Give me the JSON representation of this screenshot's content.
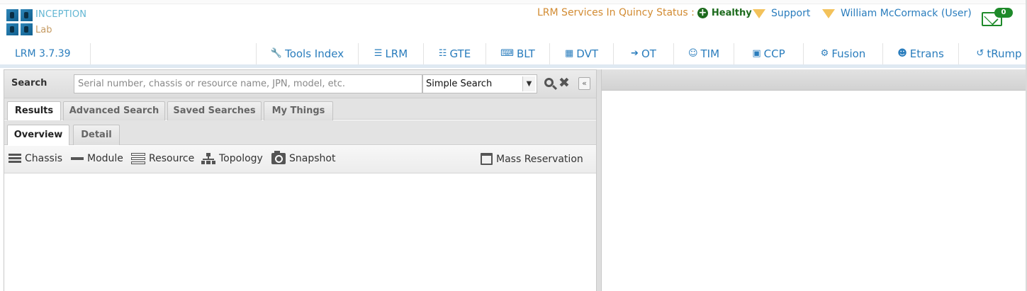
{
  "header": {
    "logo_title": "INCEPTION",
    "logo_subtitle": "Lab",
    "status_label": "LRM Services In Quincy Status :",
    "status_value": "Healthy",
    "support_label": "Support",
    "user_label": "William McCormack (User)",
    "mail_count": "0"
  },
  "nav": {
    "version": "LRM 3.7.39",
    "items": [
      {
        "label": "Tools Index",
        "icon": "🔧"
      },
      {
        "label": "LRM",
        "icon": "☰"
      },
      {
        "label": "GTE",
        "icon": "☷"
      },
      {
        "label": "BLT",
        "icon": "⌨"
      },
      {
        "label": "DVT",
        "icon": "▦"
      },
      {
        "label": "OT",
        "icon": "➔"
      },
      {
        "label": "TIM",
        "icon": "☺"
      },
      {
        "label": "CCP",
        "icon": "▣"
      },
      {
        "label": "Fusion",
        "icon": "⚙"
      },
      {
        "label": "Etrans",
        "icon": "☻"
      },
      {
        "label": "tRump",
        "icon": "↺"
      }
    ]
  },
  "search": {
    "label": "Search",
    "placeholder": "Serial number, chassis or resource name, JPN, model, etc.",
    "mode": "Simple Search"
  },
  "tabs": {
    "results": "Results",
    "advanced": "Advanced Search",
    "saved": "Saved Searches",
    "mythings": "My Things"
  },
  "subtabs": {
    "overview": "Overview",
    "detail": "Detail"
  },
  "toolbar": {
    "chassis": "Chassis",
    "module": "Module",
    "resource": "Resource",
    "topology": "Topology",
    "snapshot": "Snapshot",
    "mass_reservation": "Mass Reservation"
  }
}
